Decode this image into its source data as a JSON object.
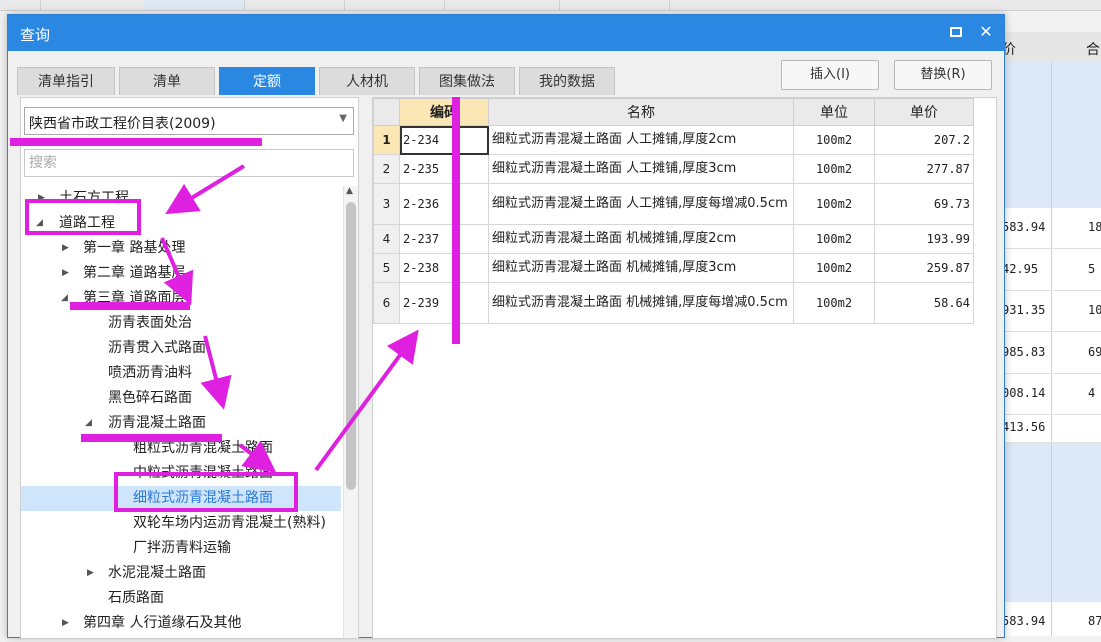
{
  "background": {
    "header_labels": [
      "价",
      "合"
    ],
    "rows": [
      {
        "v1": "583.94",
        "v2": "18"
      },
      {
        "v1": "42.95",
        "v2": "5"
      },
      {
        "v1": "931.35",
        "v2": "10"
      },
      {
        "v1": "985.83",
        "v2": "69"
      },
      {
        "v1": "008.14",
        "v2": "4"
      },
      {
        "v1": "413.56",
        "v2": ""
      },
      {
        "v1": "583.94",
        "v2": "87"
      }
    ]
  },
  "dialog": {
    "title": "查询",
    "maximize_icon": "maximize-icon",
    "close_icon": "close-icon",
    "tabs": [
      "清单指引",
      "清单",
      "定额",
      "人材机",
      "图集做法",
      "我的数据"
    ],
    "active_tab": "定额",
    "insert_label": "插入(I)",
    "replace_label": "替换(R)"
  },
  "left": {
    "catalog_value": "陕西省市政工程价目表(2009)",
    "search_placeholder": "搜索",
    "tree": [
      "土石方工程",
      "道路工程",
      "第一章 路基处理",
      "第二章 道路基层",
      "第三章 道路面层",
      "沥青表面处治",
      "沥青贯入式路面",
      "喷洒沥青油料",
      "黑色碎石路面",
      "沥青混凝土路面",
      "粗粒式沥青混凝土路面",
      "中粒式沥青混凝土路面",
      "细粒式沥青混凝土路面",
      "双轮车场内运沥青混凝土(熟料)",
      "厂拌沥青料运输",
      "水泥混凝土路面",
      "石质路面",
      "第四章 人行道缘石及其他"
    ]
  },
  "table": {
    "headers": [
      "编码",
      "名称",
      "单位",
      "单价"
    ],
    "rows": [
      {
        "no": "1",
        "code": "2-234",
        "name": "细粒式沥青混凝土路面 人工摊铺,厚度2cm",
        "unit": "100m2",
        "price": "207.2"
      },
      {
        "no": "2",
        "code": "2-235",
        "name": "细粒式沥青混凝土路面 人工摊铺,厚度3cm",
        "unit": "100m2",
        "price": "277.87"
      },
      {
        "no": "3",
        "code": "2-236",
        "name": "细粒式沥青混凝土路面 人工摊铺,厚度每增减0.5cm",
        "unit": "100m2",
        "price": "69.73"
      },
      {
        "no": "4",
        "code": "2-237",
        "name": "细粒式沥青混凝土路面 机械摊铺,厚度2cm",
        "unit": "100m2",
        "price": "193.99"
      },
      {
        "no": "5",
        "code": "2-238",
        "name": "细粒式沥青混凝土路面 机械摊铺,厚度3cm",
        "unit": "100m2",
        "price": "259.87"
      },
      {
        "no": "6",
        "code": "2-239",
        "name": "细粒式沥青混凝土路面 机械摊铺,厚度每增减0.5cm",
        "unit": "100m2",
        "price": "58.64"
      }
    ]
  },
  "annotation_color": "#e020e0"
}
